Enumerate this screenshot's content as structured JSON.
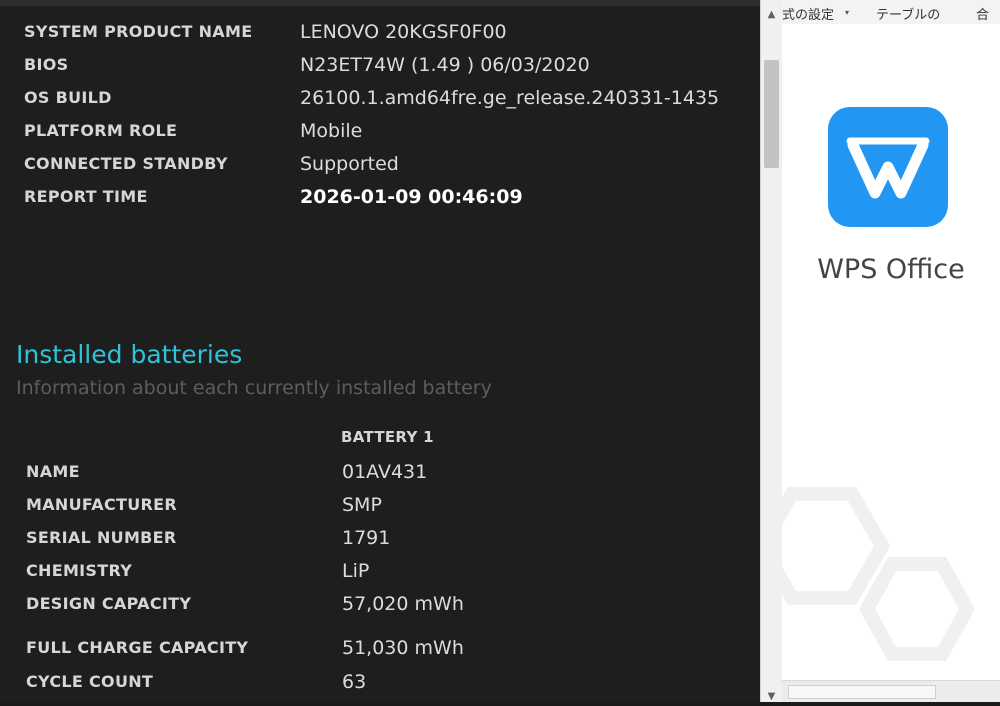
{
  "system_info": [
    {
      "key": "SYSTEM PRODUCT NAME",
      "value": "LENOVO 20KGSF0F00"
    },
    {
      "key": "BIOS",
      "value": "N23ET74W (1.49 ) 06/03/2020"
    },
    {
      "key": "OS BUILD",
      "value": "26100.1.amd64fre.ge_release.240331-1435"
    },
    {
      "key": "PLATFORM ROLE",
      "value": "Mobile"
    },
    {
      "key": "CONNECTED STANDBY",
      "value": "Supported"
    },
    {
      "key": "REPORT TIME",
      "value": "2026-01-09  00:46:09"
    }
  ],
  "batteries_section": {
    "title": "Installed batteries",
    "subtitle": "Information about each currently installed battery",
    "column_header": "BATTERY 1",
    "rows": [
      {
        "key": "NAME",
        "value": "01AV431"
      },
      {
        "key": "MANUFACTURER",
        "value": "SMP"
      },
      {
        "key": "SERIAL NUMBER",
        "value": "1791"
      },
      {
        "key": "CHEMISTRY",
        "value": "LiP"
      },
      {
        "key": "DESIGN CAPACITY",
        "value": "57,020 mWh"
      },
      {
        "key": "FULL CHARGE CAPACITY",
        "value": "51,030 mWh"
      },
      {
        "key": "CYCLE COUNT",
        "value": "63"
      }
    ]
  },
  "right_window": {
    "ribbon": [
      "式の設定",
      "テーブルの",
      "合"
    ],
    "app_name": "WPS Office"
  },
  "colors": {
    "report_bg": "#1e1e1e",
    "heading": "#2ec4d6",
    "wps_blue": "#2196f3"
  },
  "icons": {
    "scroll_up": "chevron-up-icon",
    "scroll_down": "chevron-down-icon",
    "logo": "wps-logo-icon"
  }
}
